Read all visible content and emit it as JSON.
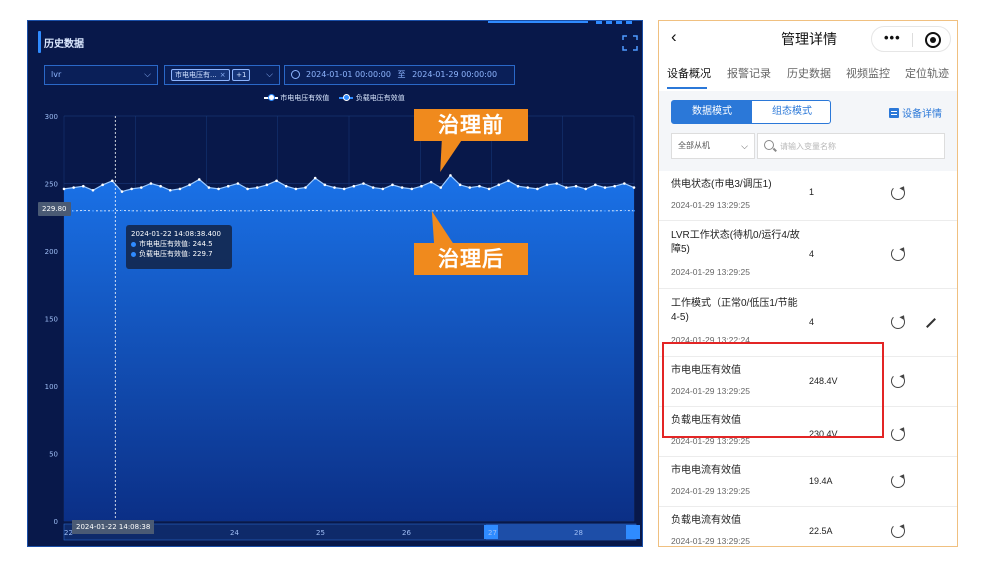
{
  "dashboard": {
    "title": "历史数据",
    "device_select": "lvr",
    "series_tag": "市电电压有...",
    "series_extra": "+1",
    "date_start": "2024-01-01 00:00:00",
    "date_sep": "至",
    "date_end": "2024-01-29 00:00:00",
    "legend": [
      "市电电压有效值",
      "负载电压有效值"
    ],
    "reference_value": "229.80",
    "tooltip": {
      "time": "2024-01-22 14:08:38.400",
      "line1": "市电电压有效值: 244.5",
      "line2": "负载电压有效值: 229.7"
    },
    "slider_label": "2024-01-22 14:08:38",
    "callout_before": "治理前",
    "callout_after": "治理后",
    "colors": {
      "background": "#08184a",
      "accent": "#2f8bff",
      "callout": "#f08a1d"
    }
  },
  "chart_data": {
    "type": "area",
    "ylim": [
      0,
      300
    ],
    "yticks": [
      "300",
      "250",
      "200",
      "150",
      "100",
      "50",
      "0"
    ],
    "x_slider_ticks": [
      "22",
      "24",
      "25",
      "26",
      "27",
      "28"
    ],
    "series": [
      {
        "name": "市电电压有效值",
        "values": [
          246,
          247,
          248,
          245,
          249,
          252,
          244,
          246,
          247,
          250,
          248,
          245,
          246,
          249,
          253,
          247,
          246,
          248,
          250,
          246,
          247,
          249,
          252,
          248,
          246,
          247,
          254,
          249,
          247,
          246,
          248,
          250,
          247,
          246,
          249,
          247,
          246,
          248,
          251,
          247,
          256,
          249,
          247,
          248,
          246,
          249,
          252,
          248,
          247,
          246,
          249,
          250,
          247,
          248,
          246,
          249,
          247,
          248,
          250,
          247
        ]
      },
      {
        "name": "负载电压有效值",
        "values": [
          229.8,
          229.7,
          229.9,
          229.8,
          229.7,
          229.8,
          229.9,
          229.8,
          229.7,
          229.8,
          229.8,
          229.9,
          229.7,
          229.8,
          229.8,
          229.7,
          229.9,
          229.8,
          229.8,
          229.7,
          229.8,
          229.9,
          229.8,
          229.7,
          229.8,
          229.8,
          229.9,
          229.7,
          229.8,
          229.8,
          229.7,
          229.8,
          229.9,
          229.8,
          229.7,
          229.8,
          229.8,
          229.9,
          229.7,
          229.8,
          229.8,
          229.7,
          229.9,
          229.8,
          229.8,
          229.7,
          229.8,
          229.9,
          229.8,
          229.7,
          229.8,
          229.8,
          229.9,
          229.7,
          229.8,
          229.8,
          229.7,
          229.8,
          229.9,
          229.8
        ]
      }
    ]
  },
  "mobile": {
    "title": "管理详情",
    "more_label": "•••",
    "tabs": [
      "设备概况",
      "报警记录",
      "历史数据",
      "视频监控",
      "定位轨迹"
    ],
    "mode_on": "数据模式",
    "mode_off": "组态模式",
    "detail_link": "设备详情",
    "filter_value": "全部从机",
    "search_placeholder": "请输入变量名称",
    "rows": [
      {
        "name": "供电状态(市电3/调压1)",
        "time": "2024-01-29 13:29:25",
        "value": "1"
      },
      {
        "name": "LVR工作状态(待机0/运行4/故障5)",
        "time": "2024-01-29 13:29:25",
        "value": "4"
      },
      {
        "name": "工作模式（正常0/低压1/节能4-5)",
        "time": "2024-01-29 13:22:24",
        "value": "4"
      },
      {
        "name": "市电电压有效值",
        "time": "2024-01-29 13:29:25",
        "value": "248.4V"
      },
      {
        "name": "负载电压有效值",
        "time": "2024-01-29 13:29:25",
        "value": "230.4V"
      },
      {
        "name": "市电电流有效值",
        "time": "2024-01-29 13:29:25",
        "value": "19.4A"
      },
      {
        "name": "负载电流有效值",
        "time": "2024-01-29 13:29:25",
        "value": "22.5A"
      }
    ],
    "colors": {
      "primary": "#2b78d8",
      "highlight": "#e32525",
      "border": "#f0c080"
    }
  }
}
